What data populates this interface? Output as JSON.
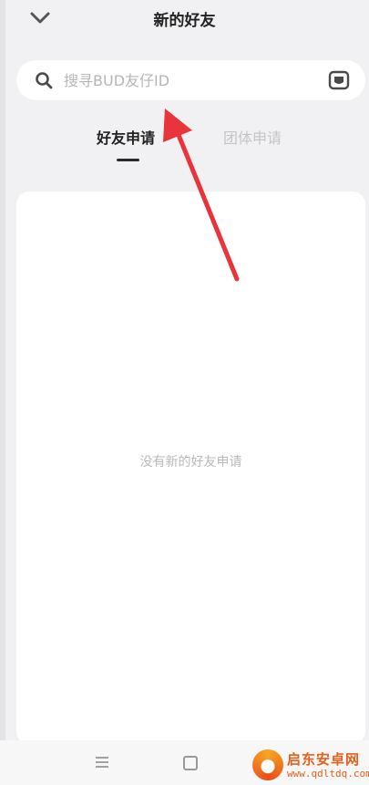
{
  "header": {
    "title": "新的好友",
    "back_icon": "chevron-down-icon"
  },
  "search": {
    "placeholder": "搜寻BUD友仔ID",
    "value": "",
    "search_icon": "search-icon",
    "scan_icon": "scan-icon"
  },
  "tabs": [
    {
      "label": "好友申请",
      "active": true
    },
    {
      "label": "团体申请",
      "active": false
    }
  ],
  "content": {
    "empty_message": "没有新的好友申请"
  },
  "navigation": {
    "menu_icon": "menu-icon",
    "home_icon": "home-square-icon"
  },
  "watermark": {
    "title": "启东安卓网",
    "url": "www.qdltdq.com"
  },
  "colors": {
    "background": "#f1f1f3",
    "card": "#ffffff",
    "arrow": "#e8343a",
    "inactive_text": "#c4c4c4",
    "watermark": "#e3611c"
  }
}
